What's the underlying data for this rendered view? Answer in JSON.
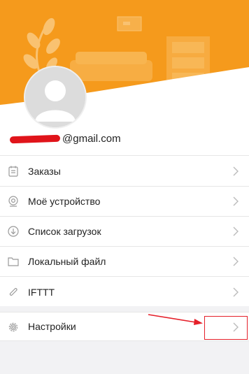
{
  "profile": {
    "email_suffix": "@gmail.com"
  },
  "menu": [
    {
      "label": "Заказы",
      "icon": "orders-icon"
    },
    {
      "label": "Моё устройство",
      "icon": "device-camera-icon"
    },
    {
      "label": "Список загрузок",
      "icon": "download-icon"
    },
    {
      "label": "Локальный файл",
      "icon": "folder-icon"
    },
    {
      "label": "IFTTT",
      "icon": "link-icon"
    }
  ],
  "settings": {
    "label": "Настройки",
    "icon": "gear-icon"
  },
  "colors": {
    "header": "#f59a1c",
    "header_light": "#f7b04a",
    "annotation": "#e5202a"
  }
}
